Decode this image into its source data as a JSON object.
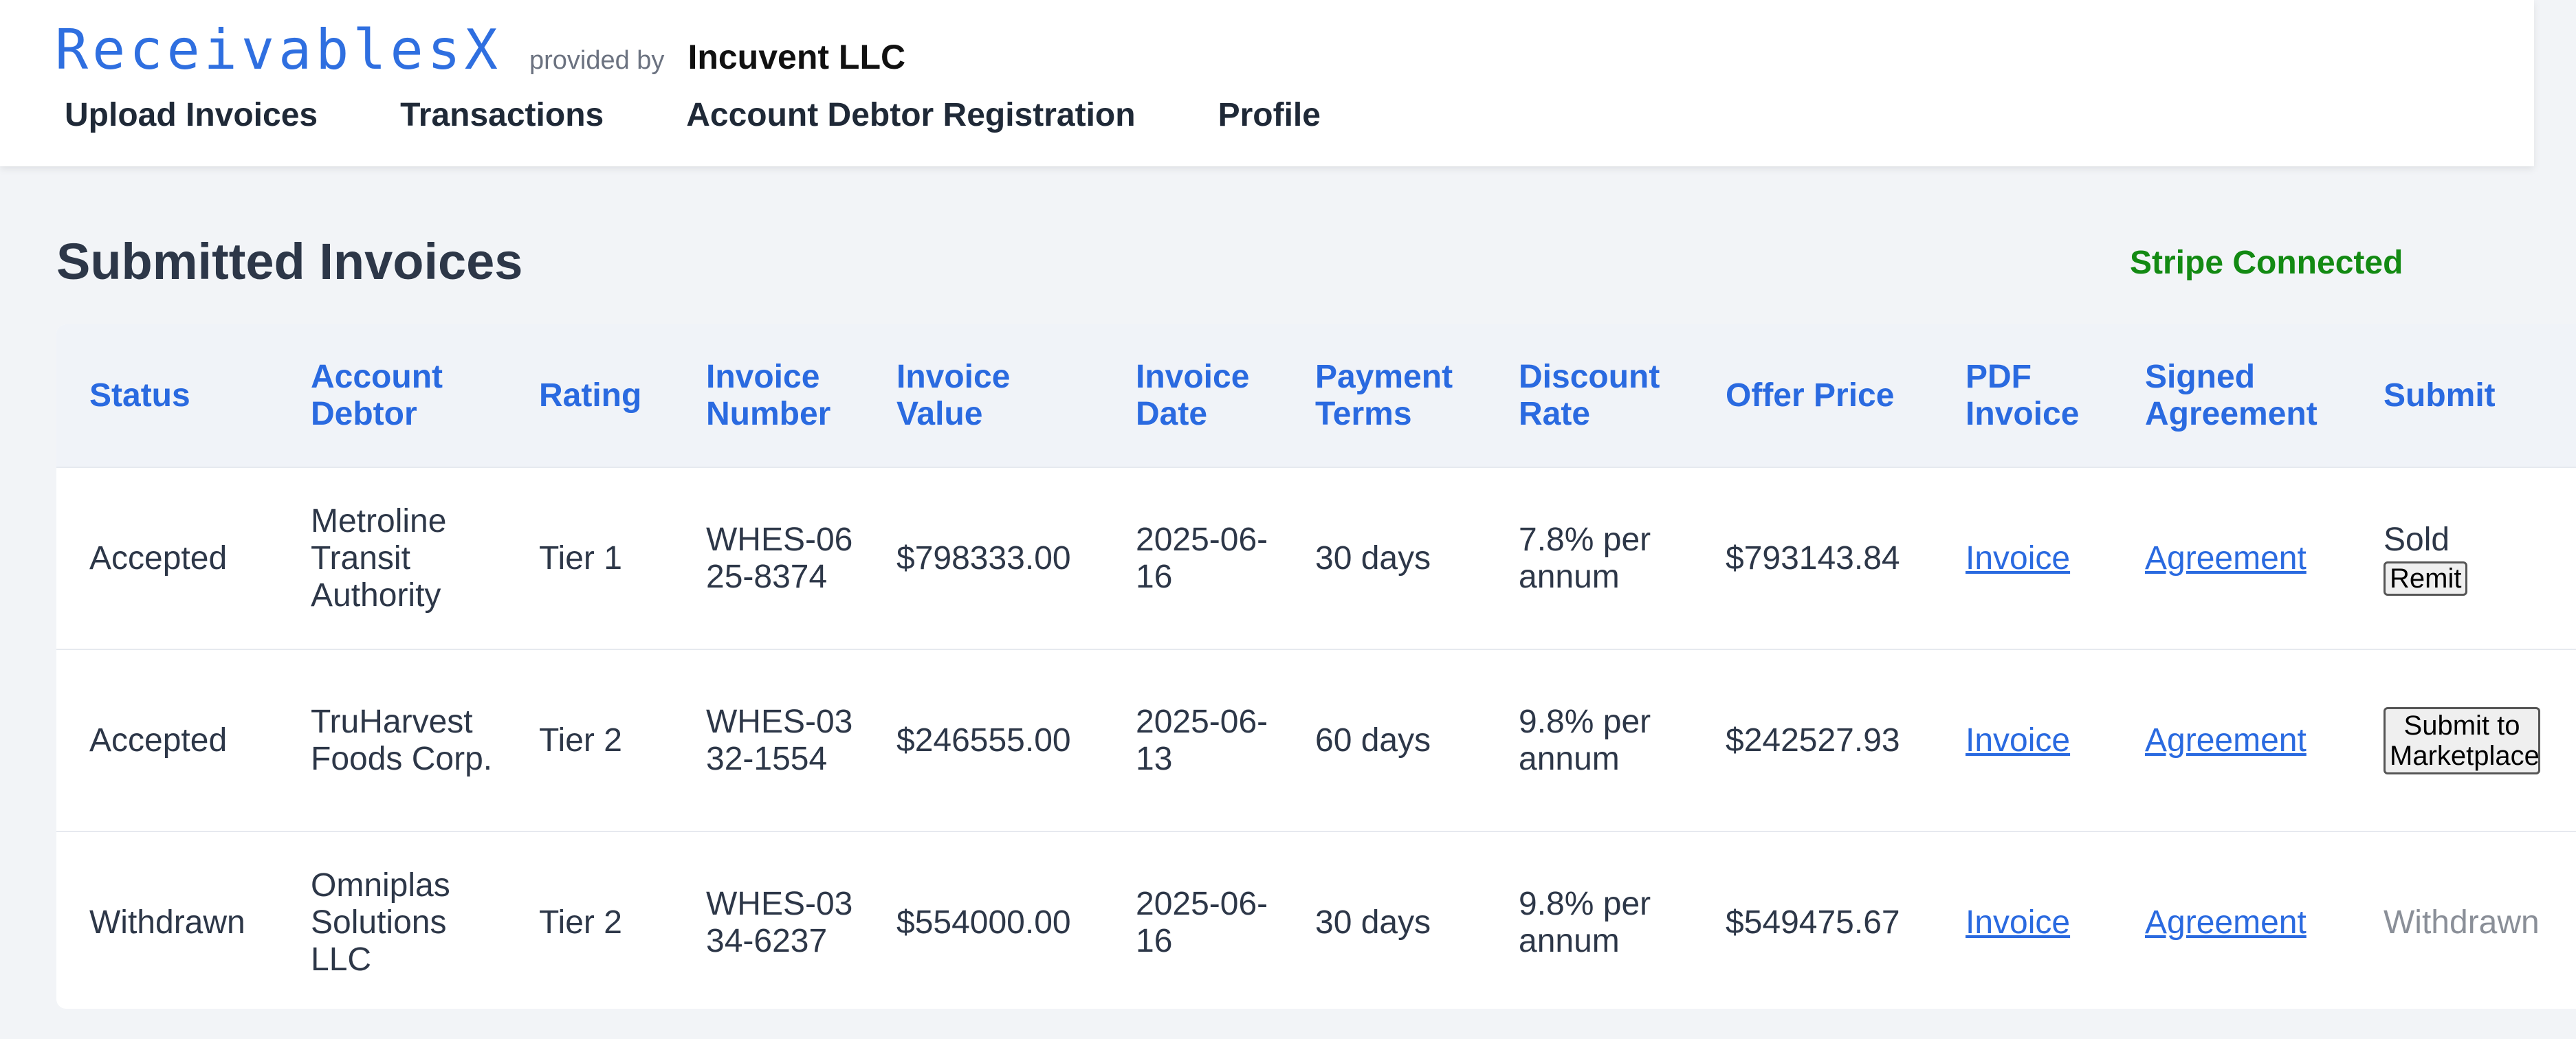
{
  "app": {
    "logo": "ReceivablesX",
    "provided_by": "provided by",
    "company": "Incuvent LLC"
  },
  "nav": [
    "Upload Invoices",
    "Transactions",
    "Account Debtor Registration",
    "Profile"
  ],
  "page_title": "Submitted Invoices",
  "stripe_status": "Stripe Connected",
  "colors": {
    "accent": "#2a6ae0",
    "success": "#138a13",
    "heading": "#2d3748",
    "muted": "#8a8f98"
  },
  "table": {
    "headers": [
      "Status",
      "Account Debtor",
      "Rating",
      "Invoice Number",
      "Invoice Value",
      "Invoice Date",
      "Payment Terms",
      "Discount Rate",
      "Offer Price",
      "PDF Invoice",
      "Signed Agreement",
      "Submit"
    ],
    "rows": [
      {
        "status": "Accepted",
        "debtor": "Metroline Transit Authority",
        "rating": "Tier 1",
        "invoice_number": "WHES-0625-8374",
        "invoice_value": "$798333.00",
        "invoice_date": "2025-06-16",
        "payment_terms": "30 days",
        "discount_rate": "7.8% per annum",
        "offer_price": "$793143.84",
        "pdf": "Invoice",
        "agreement": "Agreement",
        "submit_text": "Sold",
        "submit_button": "Remit"
      },
      {
        "status": "Accepted",
        "debtor": "TruHarvest Foods Corp.",
        "rating": "Tier 2",
        "invoice_number": "WHES-0332-1554",
        "invoice_value": "$246555.00",
        "invoice_date": "2025-06-13",
        "payment_terms": "60 days",
        "discount_rate": "9.8% per annum",
        "offer_price": "$242527.93",
        "pdf": "Invoice",
        "agreement": "Agreement",
        "submit_button": "Submit to Marketplace"
      },
      {
        "status": "Withdrawn",
        "debtor": "Omniplas Solutions LLC",
        "rating": "Tier 2",
        "invoice_number": "WHES-0334-6237",
        "invoice_value": "$554000.00",
        "invoice_date": "2025-06-16",
        "payment_terms": "30 days",
        "discount_rate": "9.8% per annum",
        "offer_price": "$549475.67",
        "pdf": "Invoice",
        "agreement": "Agreement",
        "submit_text": "Withdrawn"
      }
    ]
  }
}
